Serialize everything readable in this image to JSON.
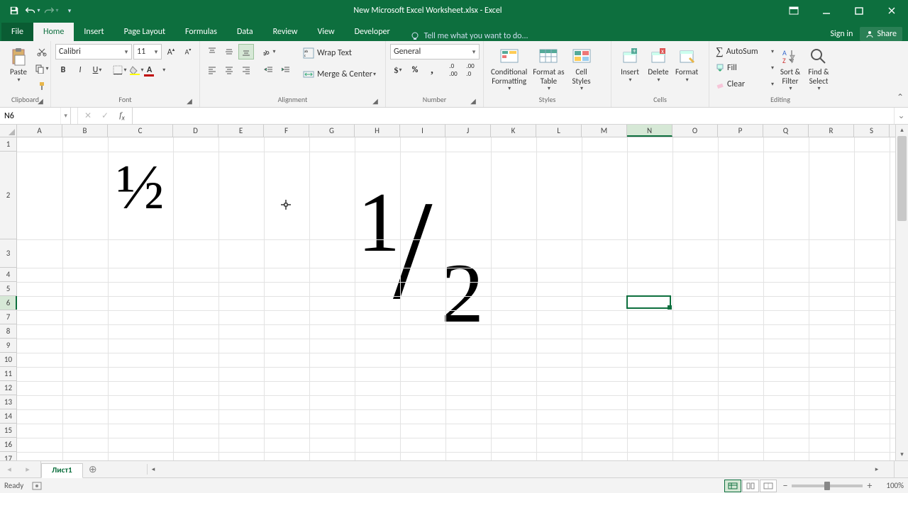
{
  "title": "New Microsoft Excel Worksheet.xlsx - Excel",
  "tabs": [
    "File",
    "Home",
    "Insert",
    "Page Layout",
    "Formulas",
    "Data",
    "Review",
    "View",
    "Developer"
  ],
  "active_tab": "Home",
  "tellme_placeholder": "Tell me what you want to do...",
  "signin": "Sign in",
  "share": "Share",
  "ribbon": {
    "clipboard": {
      "paste": "Paste",
      "label": "Clipboard"
    },
    "font": {
      "name": "Calibri",
      "size": "11",
      "label": "Font"
    },
    "alignment": {
      "wrap": "Wrap Text",
      "merge": "Merge & Center",
      "label": "Alignment"
    },
    "number": {
      "format": "General",
      "label": "Number"
    },
    "styles": {
      "cond": "Conditional Formatting",
      "cond1": "Conditional",
      "cond2": "Formatting",
      "fat": "Format as Table",
      "fat1": "Format as",
      "fat2": "Table",
      "cell": "Cell Styles",
      "cell1": "Cell",
      "cell2": "Styles",
      "label": "Styles"
    },
    "cells": {
      "insert": "Insert",
      "delete": "Delete",
      "format": "Format",
      "label": "Cells"
    },
    "editing": {
      "autosum": "AutoSum",
      "fill": "Fill",
      "clear": "Clear",
      "sort": "Sort & Filter",
      "sort1": "Sort &",
      "sort2": "Filter",
      "find": "Find & Select",
      "find1": "Find &",
      "find2": "Select",
      "label": "Editing"
    }
  },
  "namebox": "N6",
  "formula": "",
  "columns": [
    "A",
    "B",
    "C",
    "D",
    "E",
    "F",
    "G",
    "H",
    "I",
    "J",
    "K",
    "L",
    "M",
    "N",
    "O",
    "P",
    "Q",
    "R",
    "S"
  ],
  "col_widths": {
    "A": 64,
    "B": 64,
    "C": 92,
    "D": 64,
    "E": 64,
    "F": 64,
    "G": 64,
    "H": 64,
    "I": 64,
    "J": 64,
    "K": 64,
    "L": 64,
    "M": 64,
    "N": 64,
    "O": 64,
    "P": 64,
    "Q": 64,
    "R": 64,
    "S": 50
  },
  "selected_col": "N",
  "row_heights": {
    "1": 20,
    "2": 124,
    "3": 40,
    "4": 20,
    "5": 20,
    "6": 20,
    "7": 20,
    "8": 20,
    "9": 20,
    "10": 20,
    "11": 20,
    "12": 20,
    "13": 20,
    "14": 20,
    "15": 20,
    "16": 20,
    "17": 20
  },
  "selected_row": 6,
  "overlays": {
    "small_half": "½",
    "big_one": "1",
    "big_slash": "/",
    "big_two": "2"
  },
  "sheet_tab": "Лист1",
  "status": "Ready",
  "zoom": "100%"
}
